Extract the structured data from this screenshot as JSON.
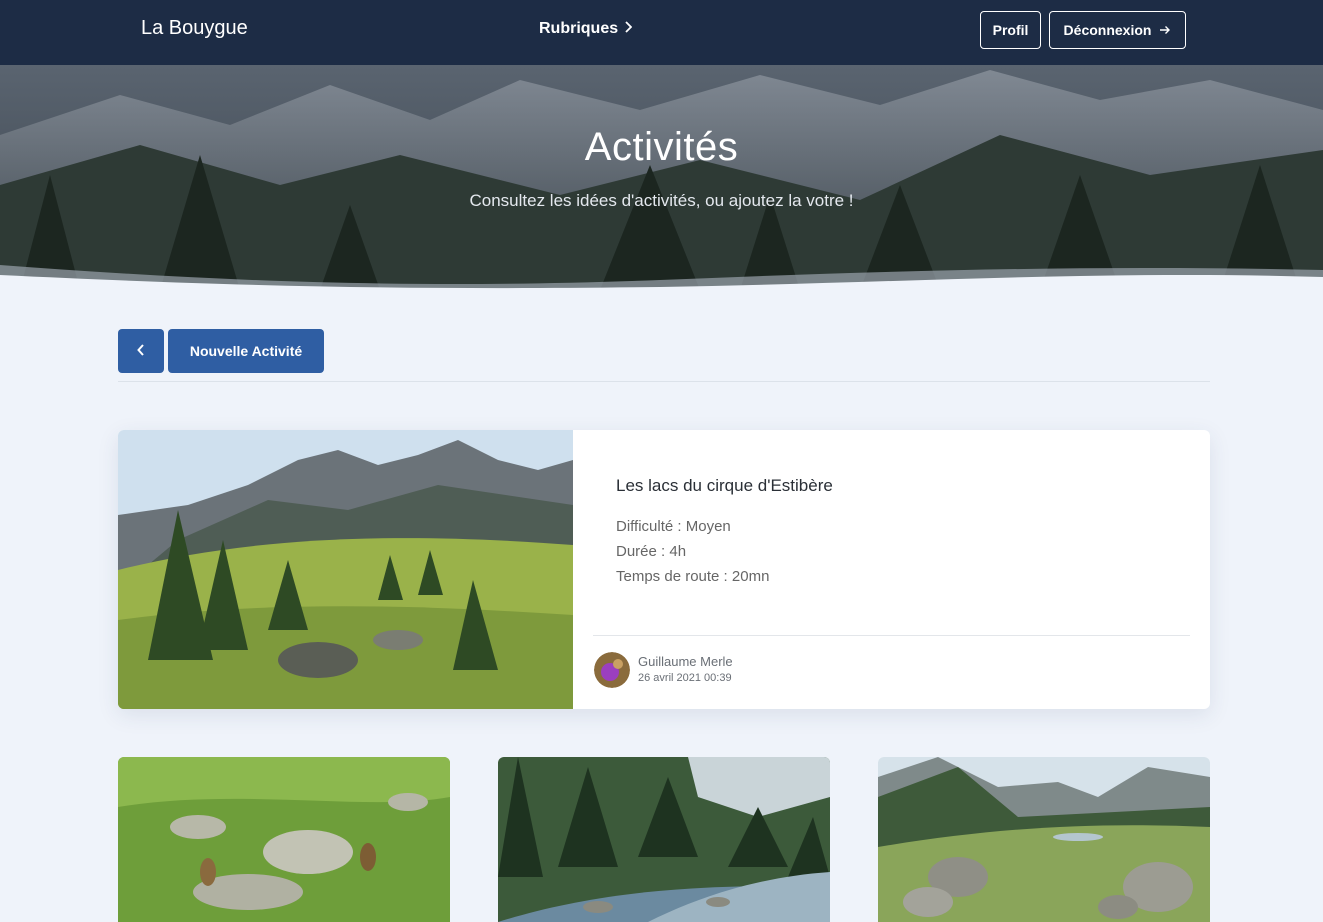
{
  "nav": {
    "brand": "La Bouygue",
    "rubriques_label": "Rubriques",
    "profil_label": "Profil",
    "logout_label": "Déconnexion"
  },
  "hero": {
    "title": "Activités",
    "subtitle": "Consultez les idées d'activités, ou ajoutez la votre !"
  },
  "toolbar": {
    "new_label": "Nouvelle Activité"
  },
  "featured": {
    "title": "Les lacs du cirque d'Estibère",
    "difficulty": "Difficulté : Moyen",
    "duration": "Durée : 4h",
    "drive_time": "Temps de route : 20mn",
    "author": "Guillaume Merle",
    "date": "26 avril 2021 00:39"
  },
  "colors": {
    "nav_bg": "#1d2c45",
    "primary": "#2f5ea3",
    "page_bg": "#eff3fa"
  },
  "icons": [
    "chevron-right-icon",
    "arrow-right-icon",
    "chevron-left-icon"
  ]
}
